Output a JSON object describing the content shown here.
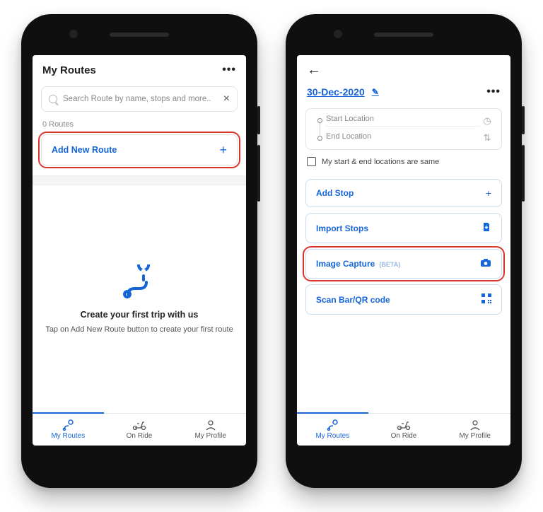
{
  "colors": {
    "accent": "#1565d8",
    "highlight": "#d9332a"
  },
  "screen1": {
    "title": "My Routes",
    "search_placeholder": "Search Route by name, stops and more..",
    "routes_count": "0 Routes",
    "add_route_label": "Add New Route",
    "empty_title": "Create your first trip with us",
    "empty_sub": "Tap on Add New Route button to create your first route"
  },
  "screen2": {
    "date_label": "30-Dec-2020",
    "start_label": "Start Location",
    "end_label": "End Location",
    "same_label": "My start & end locations are same",
    "options": {
      "add_stop": "Add Stop",
      "import_stops": "Import Stops",
      "image_capture": "Image Capture",
      "image_capture_badge": "(BETA)",
      "scan_code": "Scan Bar/QR code"
    }
  },
  "bottom_nav": {
    "routes": "My Routes",
    "on_ride": "On Ride",
    "profile": "My Profile"
  }
}
